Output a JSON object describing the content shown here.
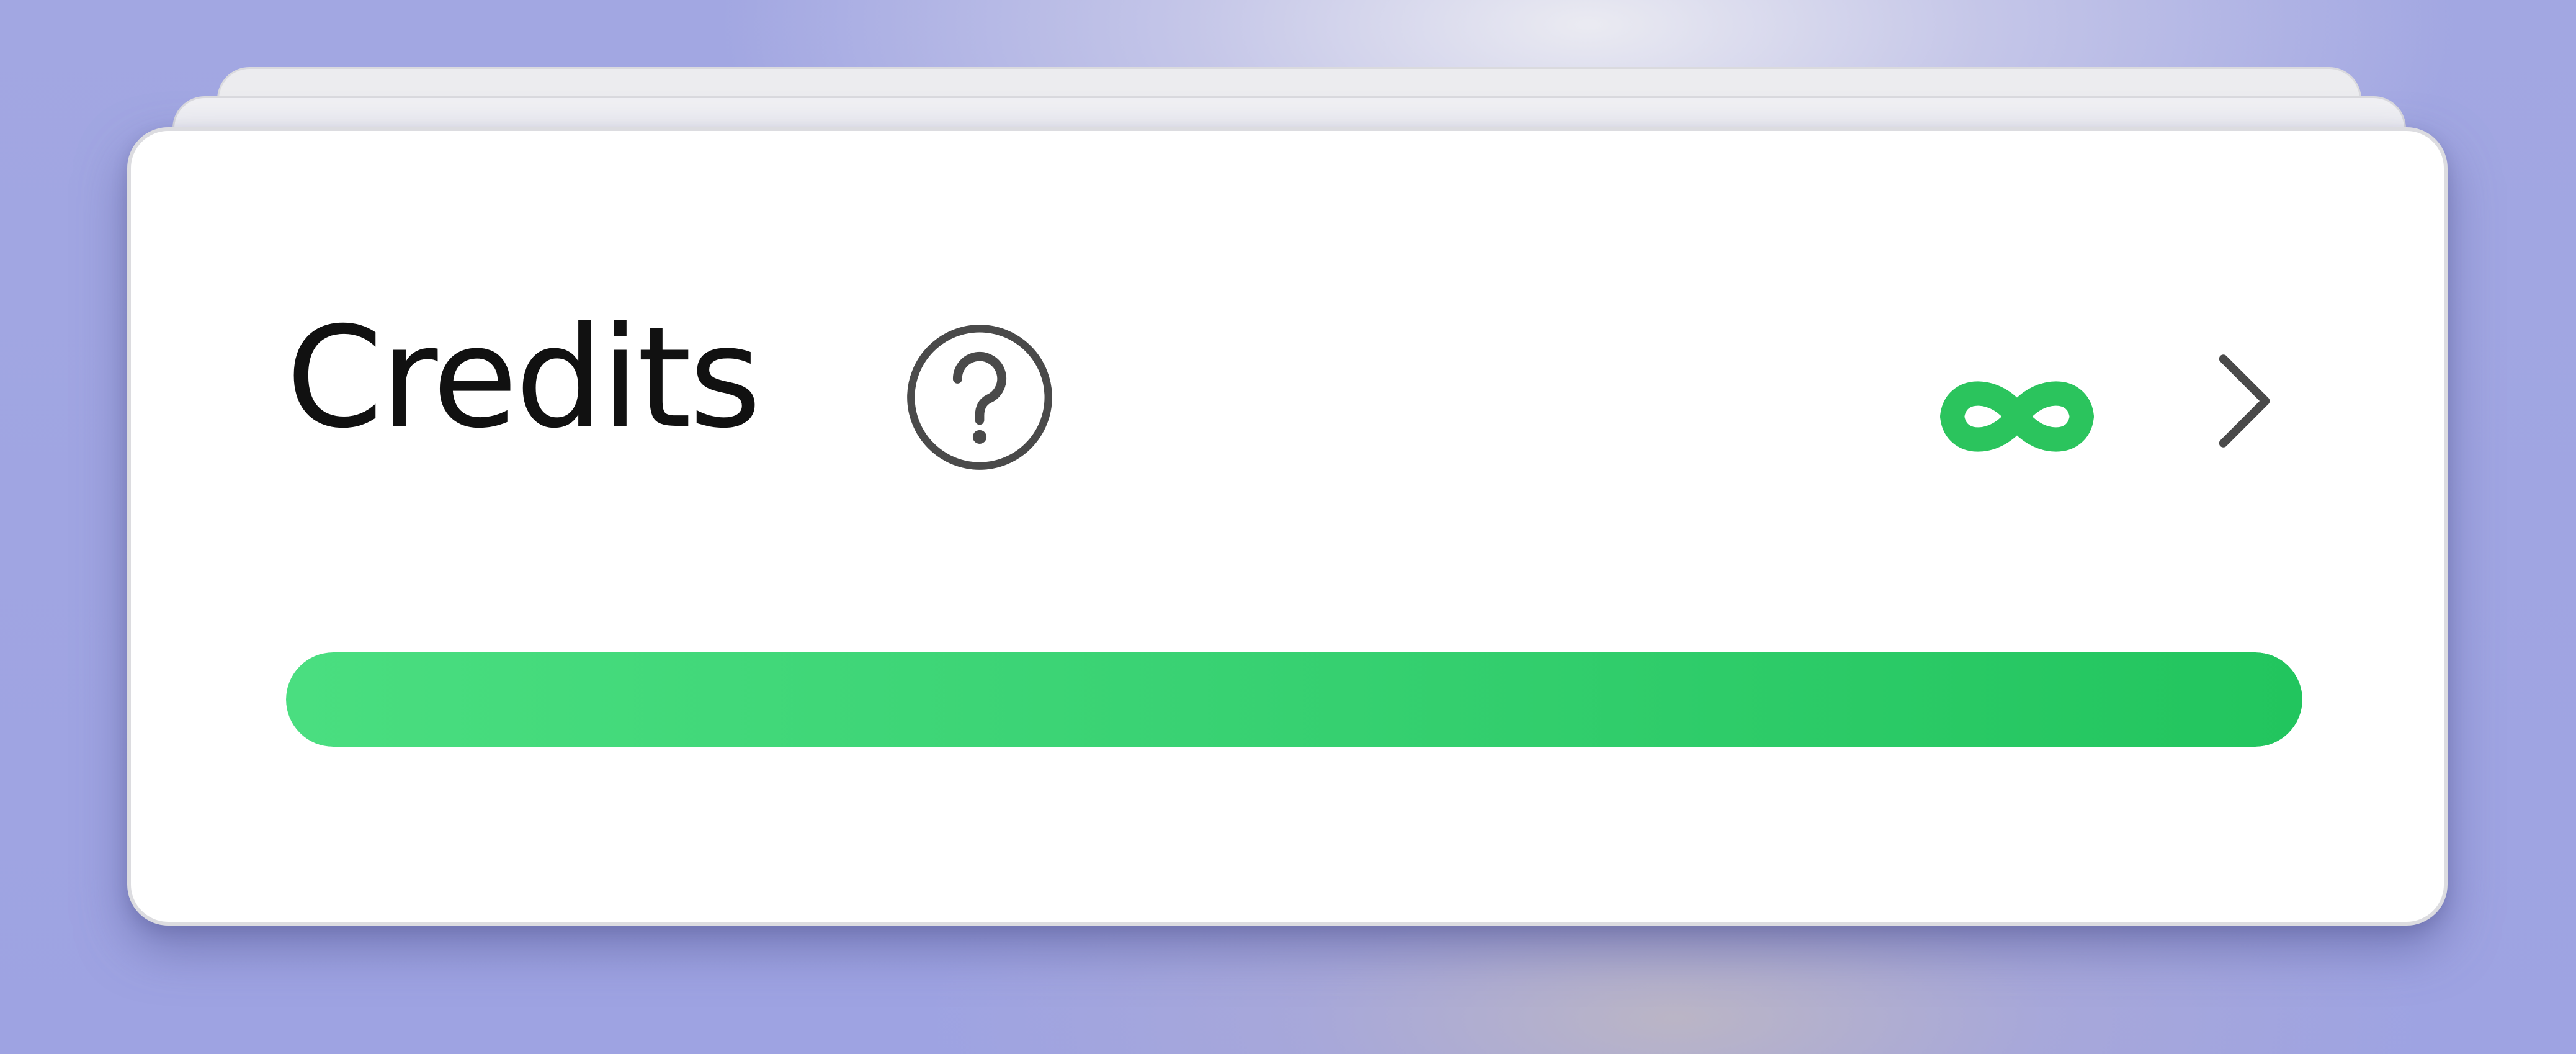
{
  "credits_panel": {
    "title": "Credits",
    "balance_symbol": "∞",
    "balance_icon": "infinity-icon",
    "help_icon": "question-circle-icon",
    "chevron_icon": "chevron-right-icon",
    "progress_fraction": 1.0
  },
  "colors": {
    "accent_green": "#22c55e",
    "accent_green_light": "#4ade80",
    "icon_gray": "#4a4a4a"
  }
}
